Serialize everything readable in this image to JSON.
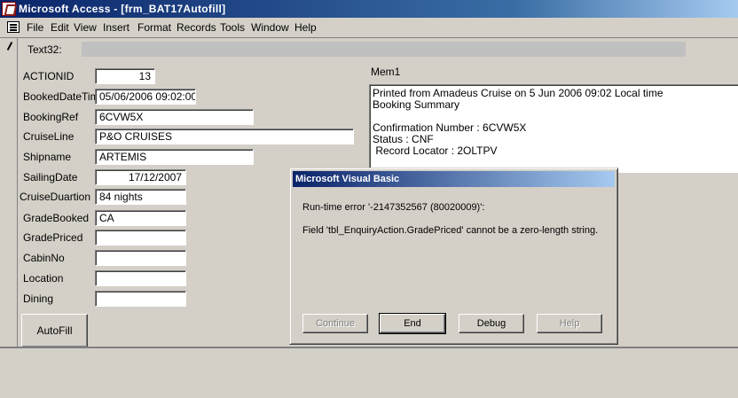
{
  "window": {
    "title": "Microsoft Access - [frm_BAT17Autofill]",
    "icon": "access-key-icon"
  },
  "menubar": {
    "icon": "form-icon",
    "items": [
      "File",
      "Edit",
      "View",
      "Insert",
      "Format",
      "Records",
      "Tools",
      "Window",
      "Help"
    ]
  },
  "form": {
    "text32_label": "Text32:",
    "fields": [
      {
        "label": "ACTIONID",
        "value": "13"
      },
      {
        "label": "BookedDateTim",
        "value": "05/06/2006 09:02:00"
      },
      {
        "label": "BookingRef",
        "value": "6CVW5X"
      },
      {
        "label": "CruiseLine",
        "value": "P&O CRUISES"
      },
      {
        "label": "Shipname",
        "value": "ARTEMIS"
      },
      {
        "label": "SailingDate",
        "value": "17/12/2007"
      },
      {
        "label": "CruiseDuartion",
        "value": "84 nights"
      },
      {
        "label": "GradeBooked",
        "value": "CA"
      },
      {
        "label": "GradePriced",
        "value": ""
      },
      {
        "label": "CabinNo",
        "value": ""
      },
      {
        "label": "Location",
        "value": ""
      },
      {
        "label": "Dining",
        "value": ""
      }
    ],
    "autofill_label": "AutoFill",
    "mem_label": "Mem1",
    "mem_lines": [
      "Printed from Amadeus Cruise on 5 Jun 2006 09:02 Local time",
      "Booking Summary",
      "",
      "Confirmation Number : 6CVW5X",
      "Status : CNF",
      " Record Locator : 2OLTPV"
    ]
  },
  "dialog": {
    "title": "Microsoft Visual Basic",
    "error_line": "Run-time error '-2147352567 (80020009)':",
    "message": "Field 'tbl_EnquiryAction.GradePriced' cannot be a zero-length string.",
    "buttons": {
      "continue": "Continue",
      "end": "End",
      "debug": "Debug",
      "help": "Help"
    }
  }
}
